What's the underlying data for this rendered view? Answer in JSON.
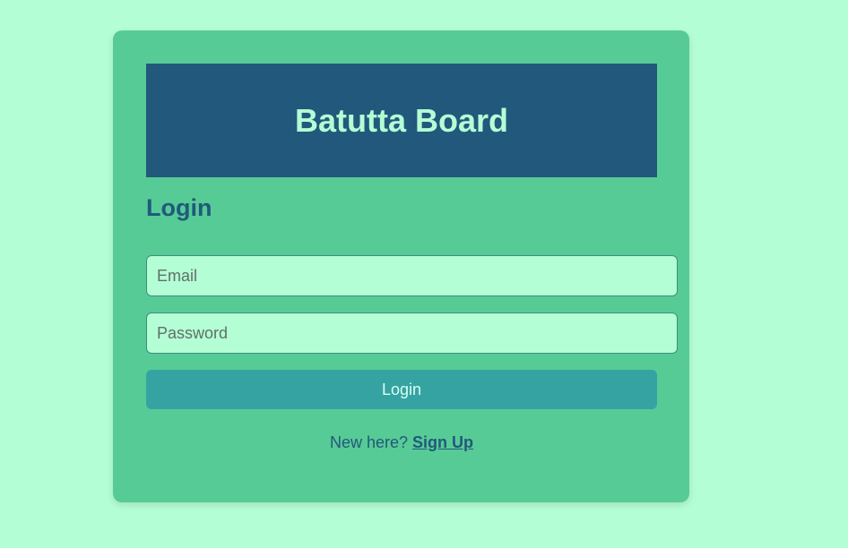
{
  "app": {
    "title": "Batutta Board"
  },
  "login": {
    "heading": "Login",
    "email_placeholder": "Email",
    "password_placeholder": "Password",
    "submit_label": "Login"
  },
  "signup": {
    "prompt": "New here?",
    "link_label": "Sign Up"
  },
  "colors": {
    "background": "#b4fed5",
    "card": "#57cb96",
    "banner": "#22587c",
    "button": "#36a3a3"
  }
}
